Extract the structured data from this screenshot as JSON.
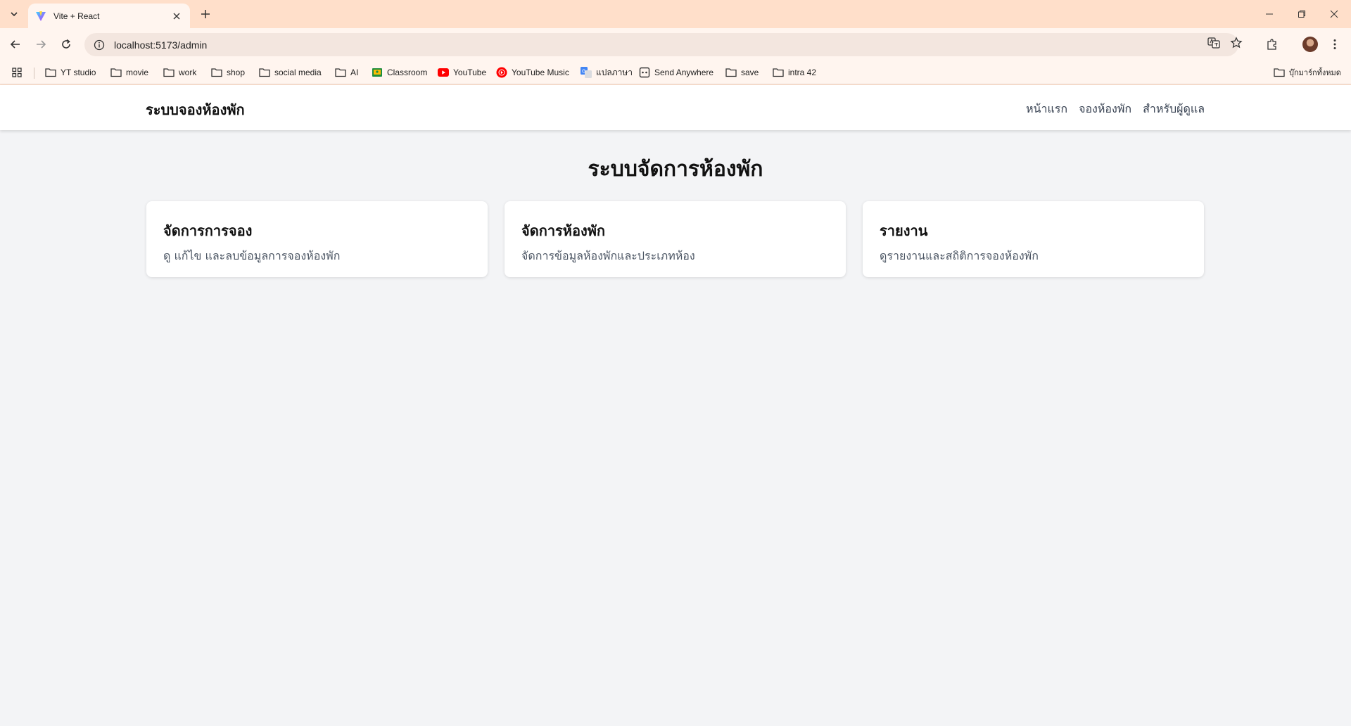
{
  "browser": {
    "tab_title": "Vite + React",
    "url": "localhost:5173/admin",
    "bookmarks": [
      {
        "label": "YT studio",
        "icon": "folder-icon"
      },
      {
        "label": "movie",
        "icon": "folder-icon"
      },
      {
        "label": "work",
        "icon": "folder-icon"
      },
      {
        "label": "shop",
        "icon": "folder-icon"
      },
      {
        "label": "social media",
        "icon": "folder-icon"
      },
      {
        "label": "AI",
        "icon": "folder-icon"
      },
      {
        "label": "Classroom",
        "icon": "classroom-icon"
      },
      {
        "label": "YouTube",
        "icon": "youtube-icon"
      },
      {
        "label": "YouTube Music",
        "icon": "youtube-music-icon"
      },
      {
        "label": "แปลภาษา",
        "icon": "translate-icon"
      },
      {
        "label": "Send Anywhere",
        "icon": "send-anywhere-icon"
      },
      {
        "label": "save",
        "icon": "folder-icon"
      },
      {
        "label": "intra 42",
        "icon": "folder-icon"
      }
    ],
    "all_bookmarks_label": "บุ๊กมาร์กทั้งหมด"
  },
  "app": {
    "brand": "ระบบจองห้องพัก",
    "nav": [
      "หน้าแรก",
      "จองห้องพัก",
      "สำหรับผู้ดูแล"
    ],
    "heading": "ระบบจัดการห้องพัก",
    "cards": [
      {
        "title": "จัดการการจอง",
        "description": "ดู แก้ไข และลบข้อมูลการจองห้องพัก"
      },
      {
        "title": "จัดการห้องพัก",
        "description": "จัดการข้อมูลห้องพักและประเภทห้อง"
      },
      {
        "title": "รายงาน",
        "description": "ดูรายงานและสถิติการจองห้องพัก"
      }
    ]
  },
  "colors": {
    "chrome_frame": "#ffdfca",
    "toolbar": "#fff5ef",
    "page_bg": "#f3f4f6",
    "youtube_red": "#ff0000"
  }
}
